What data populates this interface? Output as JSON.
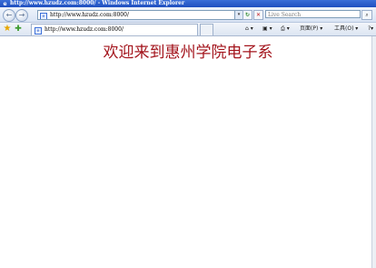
{
  "window": {
    "title": "http://www.hzudz.com:8000/ - Windows Internet Explorer"
  },
  "toolbar": {
    "back_label": "←",
    "forward_label": "→",
    "address_url": "http://www.hzudz.com:8000/",
    "refresh_label": "↻",
    "stop_label": "✕",
    "search_placeholder": "Live Search",
    "search_label": "⌕"
  },
  "tabs": [
    {
      "label": "http://www.hzudz.com:8000/"
    }
  ],
  "commands": {
    "home_label": "⌂ ▾",
    "feeds_label": "▣ ▾",
    "print_label": "⎙ ▾",
    "page_label": "页面(P) ▾",
    "tools_label": "工具(O) ▾",
    "help_label": "?▾"
  },
  "page": {
    "heading": "欢迎来到惠州学院电子系"
  },
  "colors": {
    "heading": "#a3141c",
    "titlebar": "#1f4fbf"
  }
}
